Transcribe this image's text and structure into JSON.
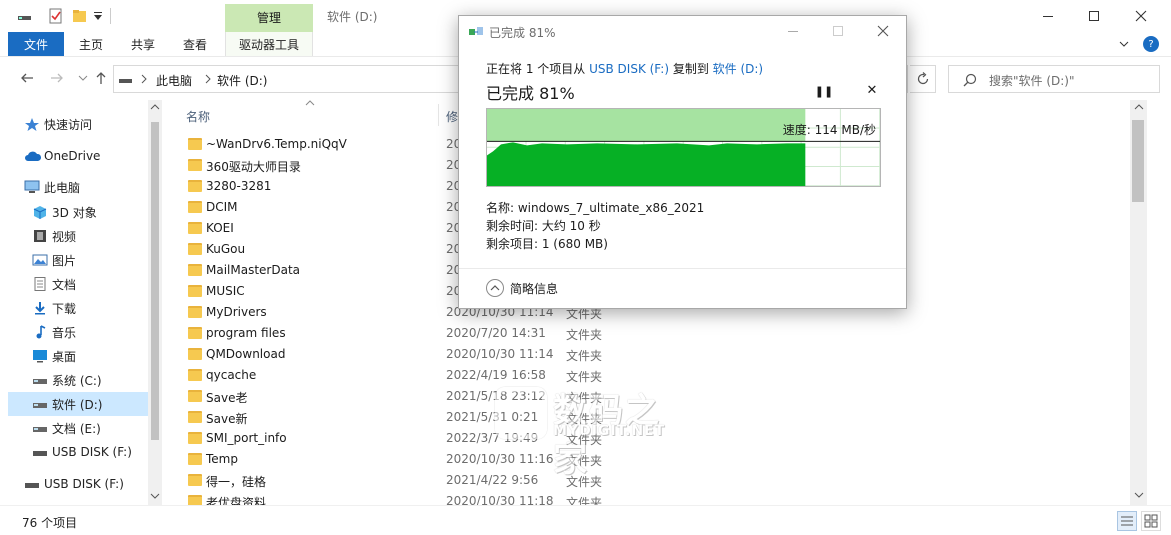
{
  "explorer": {
    "title": "软件 (D:)",
    "context_tab": "管理",
    "ribbon_tabs": [
      "文件",
      "主页",
      "共享",
      "查看",
      "驱动器工具"
    ],
    "help_glyph": "?",
    "address": {
      "root": "此电脑",
      "current": "软件 (D:)"
    },
    "search_placeholder": "搜索\"软件 (D:)\"",
    "status_count": "76 个项目",
    "accent_color": "#1a6cc2",
    "context_color": "#cbe8b4"
  },
  "nav_pane": {
    "items": [
      {
        "label": "快速访问",
        "icon": "star-icon"
      },
      {
        "label": "OneDrive",
        "icon": "cloud-icon"
      },
      {
        "label": "此电脑",
        "icon": "computer-icon"
      },
      {
        "label": "3D 对象",
        "icon": "cube-icon"
      },
      {
        "label": "视频",
        "icon": "video-icon"
      },
      {
        "label": "图片",
        "icon": "picture-icon"
      },
      {
        "label": "文档",
        "icon": "document-icon"
      },
      {
        "label": "下载",
        "icon": "download-icon"
      },
      {
        "label": "音乐",
        "icon": "music-icon"
      },
      {
        "label": "桌面",
        "icon": "desktop-icon"
      },
      {
        "label": "系统 (C:)",
        "icon": "drive-icon"
      },
      {
        "label": "软件 (D:)",
        "icon": "drive-icon",
        "selected": true
      },
      {
        "label": "文档 (E:)",
        "icon": "drive-icon"
      },
      {
        "label": "USB DISK (F:)",
        "icon": "usb-drive-icon"
      },
      {
        "label": "USB DISK (F:)",
        "icon": "usb-drive-icon"
      }
    ]
  },
  "file_list": {
    "columns": {
      "name": "名称",
      "modified": "修"
    },
    "rows": [
      {
        "name": "~WanDrv6.Temp.niQqV",
        "date": "20",
        "type": ""
      },
      {
        "name": "360驱动大师目录",
        "date": "20",
        "type": ""
      },
      {
        "name": "3280-3281",
        "date": "20",
        "type": ""
      },
      {
        "name": "DCIM",
        "date": "20",
        "type": ""
      },
      {
        "name": "KOEI",
        "date": "20",
        "type": ""
      },
      {
        "name": "KuGou",
        "date": "20",
        "type": ""
      },
      {
        "name": "MailMasterData",
        "date": "20",
        "type": ""
      },
      {
        "name": "MUSIC",
        "date": "20",
        "type": ""
      },
      {
        "name": "MyDrivers",
        "date": "2020/10/30 11:14",
        "type": "文件夹"
      },
      {
        "name": "program files",
        "date": "2020/7/20 14:31",
        "type": "文件夹"
      },
      {
        "name": "QMDownload",
        "date": "2020/10/30 11:14",
        "type": "文件夹"
      },
      {
        "name": "qycache",
        "date": "2022/4/19 16:58",
        "type": "文件夹"
      },
      {
        "name": "Save老",
        "date": "2021/5/18 23:12",
        "type": "文件夹"
      },
      {
        "name": "Save新",
        "date": "2021/5/31 0:21",
        "type": "文件夹"
      },
      {
        "name": "SMI_port_info",
        "date": "2022/3/7 19:49",
        "type": "文件夹"
      },
      {
        "name": "Temp",
        "date": "2020/10/30 11:16",
        "type": "文件夹"
      },
      {
        "name": "得一，硅格",
        "date": "2021/4/22 9:56",
        "type": "文件夹"
      },
      {
        "name": "老优盘资料",
        "date": "2020/10/30 11:18",
        "type": "文件夹"
      }
    ]
  },
  "copy_dialog": {
    "title": "已完成 81%",
    "desc_prefix": "正在将 1 个项目从 ",
    "source": "USB DISK (F:)",
    "desc_mid": " 复制到 ",
    "destination": "软件 (D:)",
    "progress_label": "已完成 81%",
    "progress": 0.81,
    "speed": "速度: 114 MB/秒",
    "speed_line_level": 0.58,
    "name_line": "名称: windows_7_ultimate_x86_2021",
    "time_line": "剩余时间: 大约 10 秒",
    "items_line": "剩余项目: 1 (680 MB)",
    "details_label": "简略信息",
    "pause_glyph": "❚❚",
    "cancel_glyph": "✕",
    "fill_color": "#06b025",
    "fill_light_color": "#a6e3a1"
  },
  "watermark": {
    "cn": "数码之家",
    "en": "MYDIGIT.NET"
  }
}
